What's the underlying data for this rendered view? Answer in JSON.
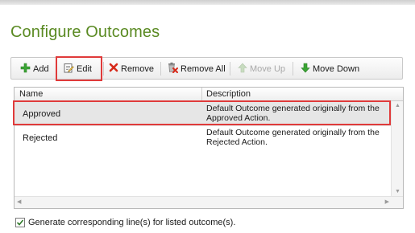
{
  "page": {
    "title": "Configure Outcomes"
  },
  "toolbar": {
    "add_label": "Add",
    "edit_label": "Edit",
    "remove_label": "Remove",
    "remove_all_label": "Remove All",
    "move_up_label": "Move Up",
    "move_down_label": "Move Down",
    "move_up_enabled": false
  },
  "grid": {
    "columns": [
      "Name",
      "Description"
    ],
    "rows": [
      {
        "name": "Approved",
        "description": "Default Outcome generated originally from the Approved Action.",
        "selected": true
      },
      {
        "name": "Rejected",
        "description": "Default Outcome generated originally from the Rejected Action.",
        "selected": false
      }
    ]
  },
  "footer": {
    "checkbox_label": "Generate corresponding line(s) for listed outcome(s).",
    "checked": true
  },
  "colors": {
    "title": "#5a8a22",
    "highlight": "#e03a3a",
    "add_icon": "#3aa534",
    "remove_icon": "#d62a1a",
    "move_icon": "#3aa534"
  }
}
